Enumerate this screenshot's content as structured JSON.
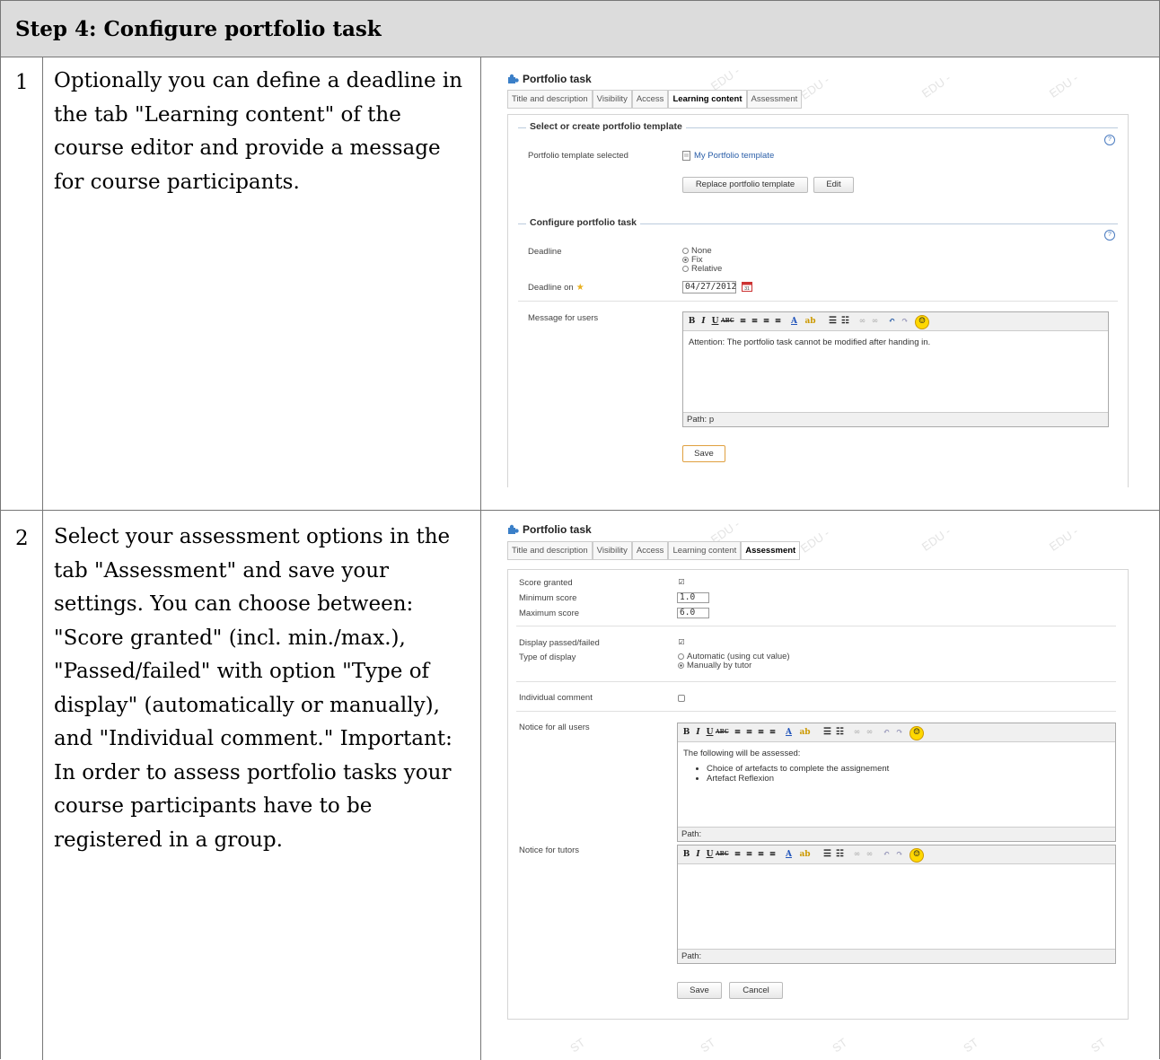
{
  "header": {
    "title": "Step 4: Configure portfolio task"
  },
  "rows": [
    {
      "number": "1",
      "text": "Optionally you can define a deadline in the tab \"Learning content\" of the course editor and provide a message for course participants."
    },
    {
      "number": "2",
      "text": "Select your assessment options in the tab \"Assessment\" and save your settings. You can choose between: \"Score granted\" (incl. min./max.), \"Passed/failed\" with option \"Type of display\" (automatically or manually), and \"Individual comment.\" Important: In order to assess portfolio tasks your course participants have to be registered in a group."
    }
  ],
  "watermark": {
    "top": "EDU -",
    "bottom": "ST"
  },
  "screenshot1": {
    "title": "Portfolio task",
    "tabs": [
      "Title and description",
      "Visibility",
      "Access",
      "Learning content",
      "Assessment"
    ],
    "active_tab": "Learning content",
    "section1_legend": "Select or create portfolio template",
    "template_label": "Portfolio template selected",
    "template_link": "My Portfolio template",
    "replace_button": "Replace portfolio template",
    "edit_button": "Edit",
    "section2_legend": "Configure portfolio task",
    "deadline_label": "Deadline",
    "deadline_options": [
      "None",
      "Fix",
      "Relative"
    ],
    "deadline_selected": "Fix",
    "deadline_on_label": "Deadline on",
    "deadline_on_value": "04/27/2012",
    "message_label": "Message for users",
    "message_text": "Attention: The portfolio task cannot be modified after handing in.",
    "editor_path": "Path: p",
    "save_button": "Save"
  },
  "screenshot2": {
    "title": "Portfolio task",
    "tabs": [
      "Title and description",
      "Visibility",
      "Access",
      "Learning content",
      "Assessment"
    ],
    "active_tab": "Assessment",
    "score_granted_label": "Score granted",
    "score_granted_checked": true,
    "min_score_label": "Minimum score",
    "min_score_value": "1.0",
    "max_score_label": "Maximum score",
    "max_score_value": "6.0",
    "display_passed_label": "Display passed/failed",
    "display_passed_checked": true,
    "type_display_label": "Type of display",
    "type_options": [
      "Automatic (using cut value)",
      "Manually by tutor"
    ],
    "type_selected": "Manually by tutor",
    "individual_comment_label": "Individual comment",
    "individual_comment_checked": false,
    "notice_all_label": "Notice for all users",
    "notice_all_intro": "The following will be assessed:",
    "notice_all_items": [
      "Choice of artefacts to complete the assignement",
      "Artefact Reflexion"
    ],
    "notice_all_path": "Path:",
    "notice_tutors_label": "Notice for tutors",
    "notice_tutors_path": "Path:",
    "save_button": "Save",
    "cancel_button": "Cancel"
  },
  "icons": {
    "puzzle": "puzzle-icon",
    "help": "help-icon",
    "document": "document-icon",
    "calendar": "calendar-icon",
    "star": "required-star-icon",
    "smiley": "smiley-icon"
  }
}
